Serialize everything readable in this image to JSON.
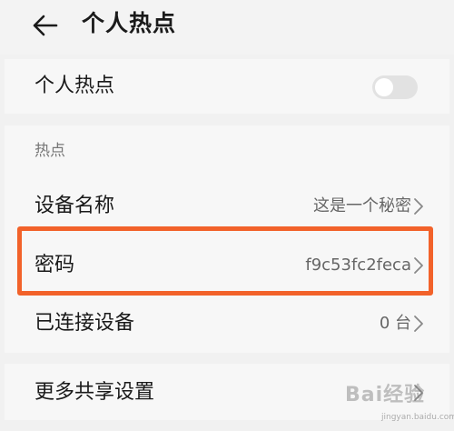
{
  "header": {
    "title": "个人热点"
  },
  "personal_hotspot": {
    "label": "个人热点",
    "enabled": false
  },
  "hotspot_section": {
    "title": "热点",
    "items": [
      {
        "label": "设备名称",
        "value": "这是一个秘密"
      },
      {
        "label": "密码",
        "value": "f9c53fc2feca"
      },
      {
        "label": "已连接设备",
        "value": "0 台"
      }
    ]
  },
  "more_settings": {
    "label": "更多共享设置"
  },
  "watermark": {
    "text": "Bai经验",
    "sub": "jingyan.baidu.com"
  },
  "colors": {
    "highlight": "#f2622a",
    "background": "#f1f1f1",
    "card": "#f7f7f7"
  }
}
